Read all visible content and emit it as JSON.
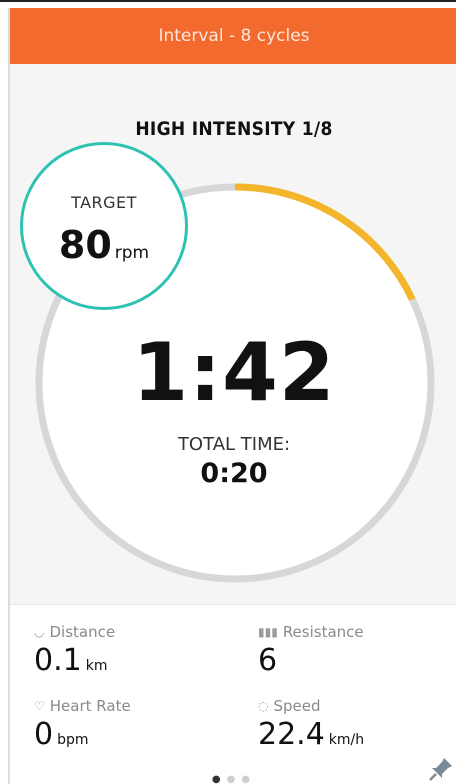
{
  "header": {
    "title": "Interval - 8 cycles"
  },
  "interval": {
    "title": "HIGH INTENSITY 1/8",
    "progress": 0.18
  },
  "target": {
    "label": "TARGET",
    "value": "80",
    "unit": "rpm"
  },
  "timer": {
    "value": "1:42"
  },
  "total_time": {
    "label": "TOTAL TIME:",
    "value": "0:20"
  },
  "stats": {
    "distance": {
      "label": "Distance",
      "value": "0.1",
      "unit": "km",
      "icon": "distance-icon"
    },
    "resistance": {
      "label": "Resistance",
      "value": "6",
      "unit": "",
      "icon": "bar-chart-icon"
    },
    "heart_rate": {
      "label": "Heart Rate",
      "value": "0",
      "unit": "bpm",
      "icon": "heart-icon"
    },
    "speed": {
      "label": "Speed",
      "value": "22.4",
      "unit": "km/h",
      "icon": "speedometer-icon"
    }
  },
  "colors": {
    "header": "#f26a2e",
    "progress": "#f4b52a",
    "target_ring": "#2dc2b1",
    "track": "#d7d7d7"
  },
  "pager": {
    "count": 3,
    "active": 0
  }
}
